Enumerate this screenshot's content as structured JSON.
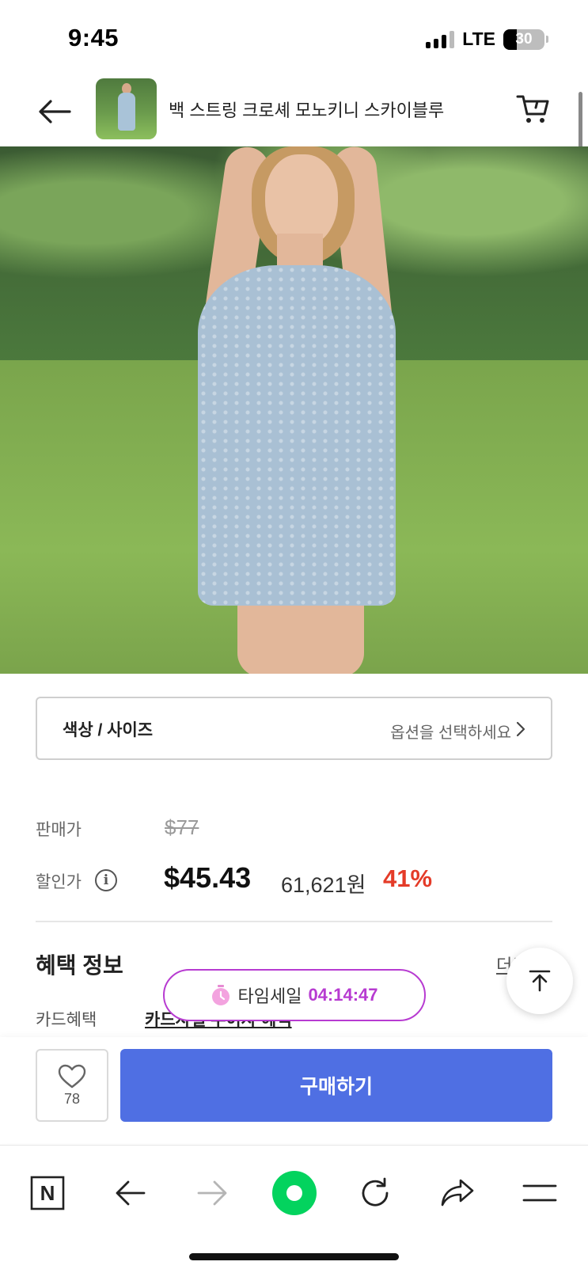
{
  "status_bar": {
    "time": "9:45",
    "network": "LTE",
    "battery": "30"
  },
  "header": {
    "title": "백 스트링 크로셰 모노키니 스카이블루"
  },
  "options": {
    "label": "색상 / 사이즈",
    "placeholder": "옵션을 선택하세요"
  },
  "price": {
    "sale_label": "판매가",
    "original": "$77",
    "discount_label": "할인가",
    "info_glyph": "i",
    "discounted": "$45.43",
    "krw": "61,621원",
    "discount_rate": "41%"
  },
  "benefits": {
    "title": "혜택 정보",
    "more": "더보기",
    "card_label": "카드혜택",
    "card_value": "카드사별 무이자 혜택"
  },
  "timesale": {
    "label": "타임세일",
    "countdown": "04:14:47"
  },
  "purchase": {
    "like_count": "78",
    "buy_label": "구매하기"
  },
  "browser": {
    "home_letter": "N"
  },
  "colors": {
    "accent": "#4f6fe3",
    "discount": "#e43b28",
    "timesale": "#b73bd1",
    "naver_green": "#03d35e"
  },
  "icons": [
    "back-arrow-icon",
    "cart-icon",
    "chevron-right-icon",
    "info-icon",
    "clock-icon",
    "arrow-up-icon",
    "heart-icon",
    "naver-n-icon",
    "browser-back-icon",
    "browser-forward-icon",
    "green-dot-icon",
    "refresh-icon",
    "share-icon",
    "menu-icon"
  ]
}
